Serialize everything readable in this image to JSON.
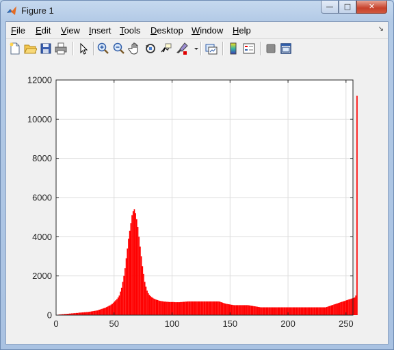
{
  "window": {
    "title": "Figure 1",
    "controls": {
      "minimize": "—",
      "maximize": "□",
      "close": "✕"
    }
  },
  "menu": {
    "items": [
      {
        "label": "File",
        "key": "F",
        "rest": "ile"
      },
      {
        "label": "Edit",
        "key": "E",
        "rest": "dit"
      },
      {
        "label": "View",
        "key": "V",
        "rest": "iew"
      },
      {
        "label": "Insert",
        "key": "I",
        "rest": "nsert"
      },
      {
        "label": "Tools",
        "key": "T",
        "rest": "ools"
      },
      {
        "label": "Desktop",
        "key": "D",
        "rest": "esktop"
      },
      {
        "label": "Window",
        "key": "W",
        "rest": "indow"
      },
      {
        "label": "Help",
        "key": "H",
        "rest": "elp"
      }
    ],
    "overflow_arrow": "↘"
  },
  "toolbar": {
    "buttons": [
      {
        "name": "new-figure",
        "icon": "new-file-icon"
      },
      {
        "name": "open-file",
        "icon": "folder-icon"
      },
      {
        "name": "save",
        "icon": "save-icon"
      },
      {
        "name": "print",
        "icon": "printer-icon"
      },
      {
        "name": "edit-plot",
        "icon": "pointer-icon"
      },
      {
        "name": "zoom-in",
        "icon": "zoom-in-icon"
      },
      {
        "name": "zoom-out",
        "icon": "zoom-out-icon"
      },
      {
        "name": "pan",
        "icon": "hand-icon"
      },
      {
        "name": "rotate-3d",
        "icon": "rotate-icon"
      },
      {
        "name": "data-cursor",
        "icon": "data-cursor-icon"
      },
      {
        "name": "brush",
        "icon": "brush-icon"
      },
      {
        "name": "link-plot",
        "icon": "link-plot-icon"
      },
      {
        "name": "colorbar",
        "icon": "colorbar-icon"
      },
      {
        "name": "legend",
        "icon": "legend-icon"
      },
      {
        "name": "hide-plot-tools",
        "icon": "hide-tools-icon"
      },
      {
        "name": "show-plot-tools",
        "icon": "show-tools-icon"
      }
    ]
  },
  "chart_data": {
    "type": "bar",
    "title": "",
    "xlabel": "",
    "ylabel": "",
    "xlim": [
      0,
      256
    ],
    "ylim": [
      0,
      12000
    ],
    "xticks": [
      "0",
      "50",
      "100",
      "150",
      "200",
      "250"
    ],
    "yticks": [
      "0",
      "2000",
      "4000",
      "6000",
      "8000",
      "10000",
      "12000"
    ],
    "grid": true,
    "bar_color": "#ff0000",
    "series": [
      {
        "x_start": 0,
        "bin_width": 1,
        "values": [
          0,
          20,
          30,
          40,
          40,
          50,
          50,
          60,
          60,
          70,
          70,
          80,
          80,
          90,
          90,
          100,
          100,
          110,
          110,
          120,
          130,
          130,
          140,
          140,
          150,
          150,
          160,
          160,
          170,
          180,
          190,
          200,
          210,
          220,
          230,
          240,
          260,
          280,
          300,
          320,
          340,
          360,
          380,
          410,
          440,
          470,
          500,
          540,
          580,
          640,
          700,
          760,
          820,
          900,
          1000,
          1200,
          1400,
          1700,
          2000,
          2400,
          2900,
          3400,
          3900,
          4300,
          4700,
          5100,
          5300,
          5400,
          5200,
          4900,
          4500,
          4000,
          3500,
          3000,
          2500,
          2100,
          1700,
          1450,
          1250,
          1120,
          1030,
          970,
          920,
          880,
          840,
          810,
          790,
          770,
          750,
          730,
          720,
          710,
          700,
          690,
          690,
          680,
          680,
          670,
          670,
          670,
          670,
          670,
          660,
          660,
          660,
          660,
          660,
          670,
          670,
          680,
          680,
          690,
          690,
          700,
          700,
          700,
          700,
          700,
          700,
          700,
          700,
          700,
          700,
          700,
          700,
          700,
          700,
          700,
          700,
          700,
          700,
          700,
          700,
          700,
          700,
          700,
          700,
          700,
          700,
          700,
          700,
          680,
          660,
          640,
          620,
          600,
          580,
          570,
          560,
          550,
          540,
          530,
          520,
          510,
          510,
          510,
          510,
          510,
          510,
          510,
          510,
          510,
          510,
          510,
          510,
          510,
          500,
          490,
          480,
          470,
          460,
          450,
          440,
          430,
          420,
          410,
          400,
          400,
          400,
          400,
          400,
          400,
          400,
          400,
          400,
          400,
          400,
          400,
          400,
          400,
          400,
          400,
          400,
          400,
          400,
          400,
          400,
          400,
          400,
          400,
          400,
          400,
          400,
          400,
          400,
          400,
          400,
          400,
          400,
          400,
          400,
          400,
          400,
          400,
          400,
          400,
          400,
          400,
          400,
          400,
          400,
          400,
          400,
          400,
          400,
          400,
          400,
          400,
          400,
          400,
          400,
          400,
          400,
          420,
          440,
          460,
          480,
          500,
          520,
          540,
          560,
          580,
          600,
          620,
          640,
          660,
          680,
          700,
          720,
          740,
          760,
          780,
          800,
          820,
          840,
          860,
          880,
          900,
          1000,
          11200
        ]
      }
    ]
  }
}
